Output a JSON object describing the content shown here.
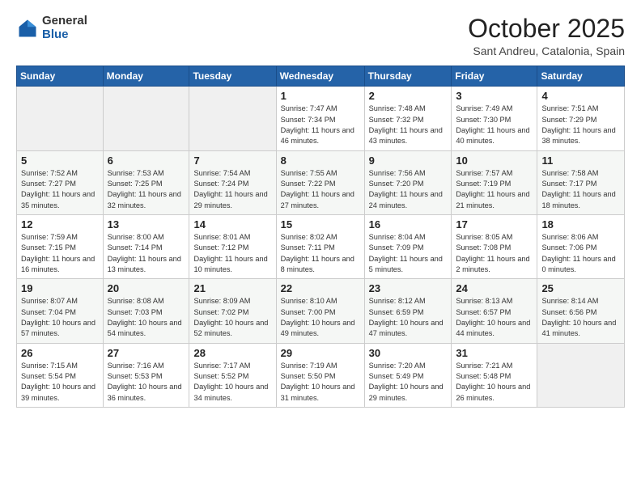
{
  "header": {
    "logo_line1": "General",
    "logo_line2": "Blue",
    "month": "October 2025",
    "location": "Sant Andreu, Catalonia, Spain"
  },
  "weekdays": [
    "Sunday",
    "Monday",
    "Tuesday",
    "Wednesday",
    "Thursday",
    "Friday",
    "Saturday"
  ],
  "weeks": [
    [
      {
        "day": "",
        "info": ""
      },
      {
        "day": "",
        "info": ""
      },
      {
        "day": "",
        "info": ""
      },
      {
        "day": "1",
        "info": "Sunrise: 7:47 AM\nSunset: 7:34 PM\nDaylight: 11 hours and 46 minutes."
      },
      {
        "day": "2",
        "info": "Sunrise: 7:48 AM\nSunset: 7:32 PM\nDaylight: 11 hours and 43 minutes."
      },
      {
        "day": "3",
        "info": "Sunrise: 7:49 AM\nSunset: 7:30 PM\nDaylight: 11 hours and 40 minutes."
      },
      {
        "day": "4",
        "info": "Sunrise: 7:51 AM\nSunset: 7:29 PM\nDaylight: 11 hours and 38 minutes."
      }
    ],
    [
      {
        "day": "5",
        "info": "Sunrise: 7:52 AM\nSunset: 7:27 PM\nDaylight: 11 hours and 35 minutes."
      },
      {
        "day": "6",
        "info": "Sunrise: 7:53 AM\nSunset: 7:25 PM\nDaylight: 11 hours and 32 minutes."
      },
      {
        "day": "7",
        "info": "Sunrise: 7:54 AM\nSunset: 7:24 PM\nDaylight: 11 hours and 29 minutes."
      },
      {
        "day": "8",
        "info": "Sunrise: 7:55 AM\nSunset: 7:22 PM\nDaylight: 11 hours and 27 minutes."
      },
      {
        "day": "9",
        "info": "Sunrise: 7:56 AM\nSunset: 7:20 PM\nDaylight: 11 hours and 24 minutes."
      },
      {
        "day": "10",
        "info": "Sunrise: 7:57 AM\nSunset: 7:19 PM\nDaylight: 11 hours and 21 minutes."
      },
      {
        "day": "11",
        "info": "Sunrise: 7:58 AM\nSunset: 7:17 PM\nDaylight: 11 hours and 18 minutes."
      }
    ],
    [
      {
        "day": "12",
        "info": "Sunrise: 7:59 AM\nSunset: 7:15 PM\nDaylight: 11 hours and 16 minutes."
      },
      {
        "day": "13",
        "info": "Sunrise: 8:00 AM\nSunset: 7:14 PM\nDaylight: 11 hours and 13 minutes."
      },
      {
        "day": "14",
        "info": "Sunrise: 8:01 AM\nSunset: 7:12 PM\nDaylight: 11 hours and 10 minutes."
      },
      {
        "day": "15",
        "info": "Sunrise: 8:02 AM\nSunset: 7:11 PM\nDaylight: 11 hours and 8 minutes."
      },
      {
        "day": "16",
        "info": "Sunrise: 8:04 AM\nSunset: 7:09 PM\nDaylight: 11 hours and 5 minutes."
      },
      {
        "day": "17",
        "info": "Sunrise: 8:05 AM\nSunset: 7:08 PM\nDaylight: 11 hours and 2 minutes."
      },
      {
        "day": "18",
        "info": "Sunrise: 8:06 AM\nSunset: 7:06 PM\nDaylight: 11 hours and 0 minutes."
      }
    ],
    [
      {
        "day": "19",
        "info": "Sunrise: 8:07 AM\nSunset: 7:04 PM\nDaylight: 10 hours and 57 minutes."
      },
      {
        "day": "20",
        "info": "Sunrise: 8:08 AM\nSunset: 7:03 PM\nDaylight: 10 hours and 54 minutes."
      },
      {
        "day": "21",
        "info": "Sunrise: 8:09 AM\nSunset: 7:02 PM\nDaylight: 10 hours and 52 minutes."
      },
      {
        "day": "22",
        "info": "Sunrise: 8:10 AM\nSunset: 7:00 PM\nDaylight: 10 hours and 49 minutes."
      },
      {
        "day": "23",
        "info": "Sunrise: 8:12 AM\nSunset: 6:59 PM\nDaylight: 10 hours and 47 minutes."
      },
      {
        "day": "24",
        "info": "Sunrise: 8:13 AM\nSunset: 6:57 PM\nDaylight: 10 hours and 44 minutes."
      },
      {
        "day": "25",
        "info": "Sunrise: 8:14 AM\nSunset: 6:56 PM\nDaylight: 10 hours and 41 minutes."
      }
    ],
    [
      {
        "day": "26",
        "info": "Sunrise: 7:15 AM\nSunset: 5:54 PM\nDaylight: 10 hours and 39 minutes."
      },
      {
        "day": "27",
        "info": "Sunrise: 7:16 AM\nSunset: 5:53 PM\nDaylight: 10 hours and 36 minutes."
      },
      {
        "day": "28",
        "info": "Sunrise: 7:17 AM\nSunset: 5:52 PM\nDaylight: 10 hours and 34 minutes."
      },
      {
        "day": "29",
        "info": "Sunrise: 7:19 AM\nSunset: 5:50 PM\nDaylight: 10 hours and 31 minutes."
      },
      {
        "day": "30",
        "info": "Sunrise: 7:20 AM\nSunset: 5:49 PM\nDaylight: 10 hours and 29 minutes."
      },
      {
        "day": "31",
        "info": "Sunrise: 7:21 AM\nSunset: 5:48 PM\nDaylight: 10 hours and 26 minutes."
      },
      {
        "day": "",
        "info": ""
      }
    ]
  ]
}
